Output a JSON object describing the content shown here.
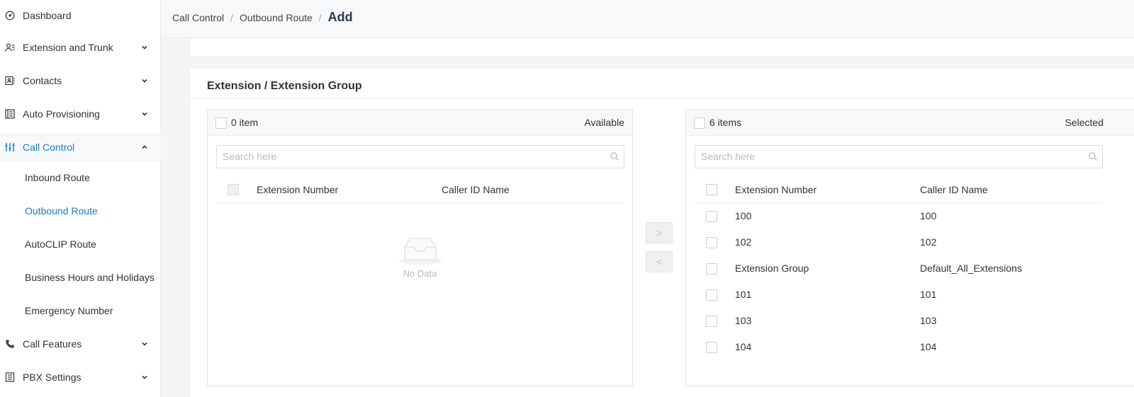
{
  "sidebar": {
    "items": [
      {
        "label": "Dashboard"
      },
      {
        "label": "Extension and Trunk"
      },
      {
        "label": "Contacts"
      },
      {
        "label": "Auto Provisioning"
      },
      {
        "label": "Call Control"
      },
      {
        "label": "Call Features"
      },
      {
        "label": "PBX Settings"
      }
    ],
    "call_control_sub": [
      {
        "label": "Inbound Route"
      },
      {
        "label": "Outbound Route"
      },
      {
        "label": "AutoCLIP Route"
      },
      {
        "label": "Business Hours and Holidays"
      },
      {
        "label": "Emergency Number"
      }
    ]
  },
  "breadcrumb": {
    "level1": "Call Control",
    "level2": "Outbound Route",
    "current": "Add",
    "separator": "/"
  },
  "section": {
    "title": "Extension / Extension Group"
  },
  "available": {
    "count": "0 item",
    "title": "Available",
    "search_placeholder": "Search here",
    "col_number": "Extension Number",
    "col_name": "Caller ID Name",
    "empty_text": "No Data"
  },
  "selected": {
    "count": "6 items",
    "title": "Selected",
    "search_placeholder": "Search here",
    "col_number": "Extension Number",
    "col_name": "Caller ID Name",
    "rows": [
      {
        "number": "100",
        "name": "100"
      },
      {
        "number": "102",
        "name": "102"
      },
      {
        "number": "Extension Group",
        "name": "Default_All_Extensions"
      },
      {
        "number": "101",
        "name": "101"
      },
      {
        "number": "103",
        "name": "103"
      },
      {
        "number": "104",
        "name": "104"
      }
    ]
  },
  "transfer": {
    "right_glyph": ">",
    "left_glyph": "<"
  },
  "colors": {
    "accent": "#1d7cc0",
    "sidebar_bg": "#ffffff",
    "page_bg": "#f4f5f7"
  }
}
